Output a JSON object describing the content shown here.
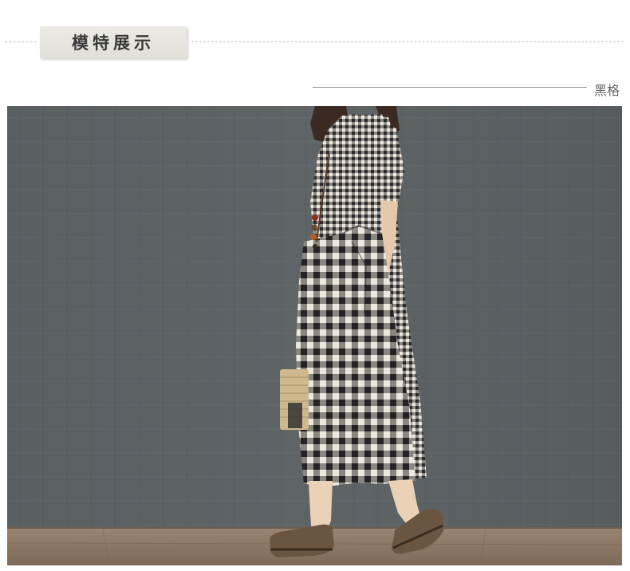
{
  "section": {
    "title": "模特展示"
  },
  "variant": {
    "color_label": "黑格"
  },
  "colors": {
    "wall": "#5e6366",
    "floor": "#8a7462",
    "dress_dark": "#2c2c2c",
    "dress_light": "#e9e5dc",
    "shoes": "#6b5540"
  },
  "photo": {
    "subject": "model-in-gingham-dress"
  }
}
